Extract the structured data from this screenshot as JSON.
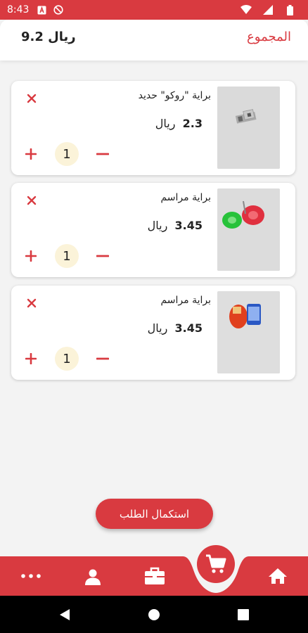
{
  "status_bar": {
    "time": "8:43"
  },
  "header": {
    "total_label": "المجموع",
    "total_value": "9.2 ريال"
  },
  "cart_items": [
    {
      "name": "براية \"روكو\" حديد",
      "price": "2.3",
      "currency": "ريال",
      "quantity": "1"
    },
    {
      "name": "براية مراسم",
      "price": "3.45",
      "currency": "ريال",
      "quantity": "1"
    },
    {
      "name": "براية مراسم",
      "price": "3.45",
      "currency": "ريال",
      "quantity": "1"
    }
  ],
  "checkout_label": "استكمال الطلب",
  "colors": {
    "accent": "#d93a40",
    "qty_bg": "#fbf3d9",
    "background": "#f3f3f3"
  },
  "icons": {
    "nav": [
      "more-icon",
      "profile-icon",
      "briefcase-icon",
      "cart-icon",
      "home-icon"
    ],
    "item": [
      "close-icon",
      "plus-icon",
      "minus-icon"
    ]
  }
}
